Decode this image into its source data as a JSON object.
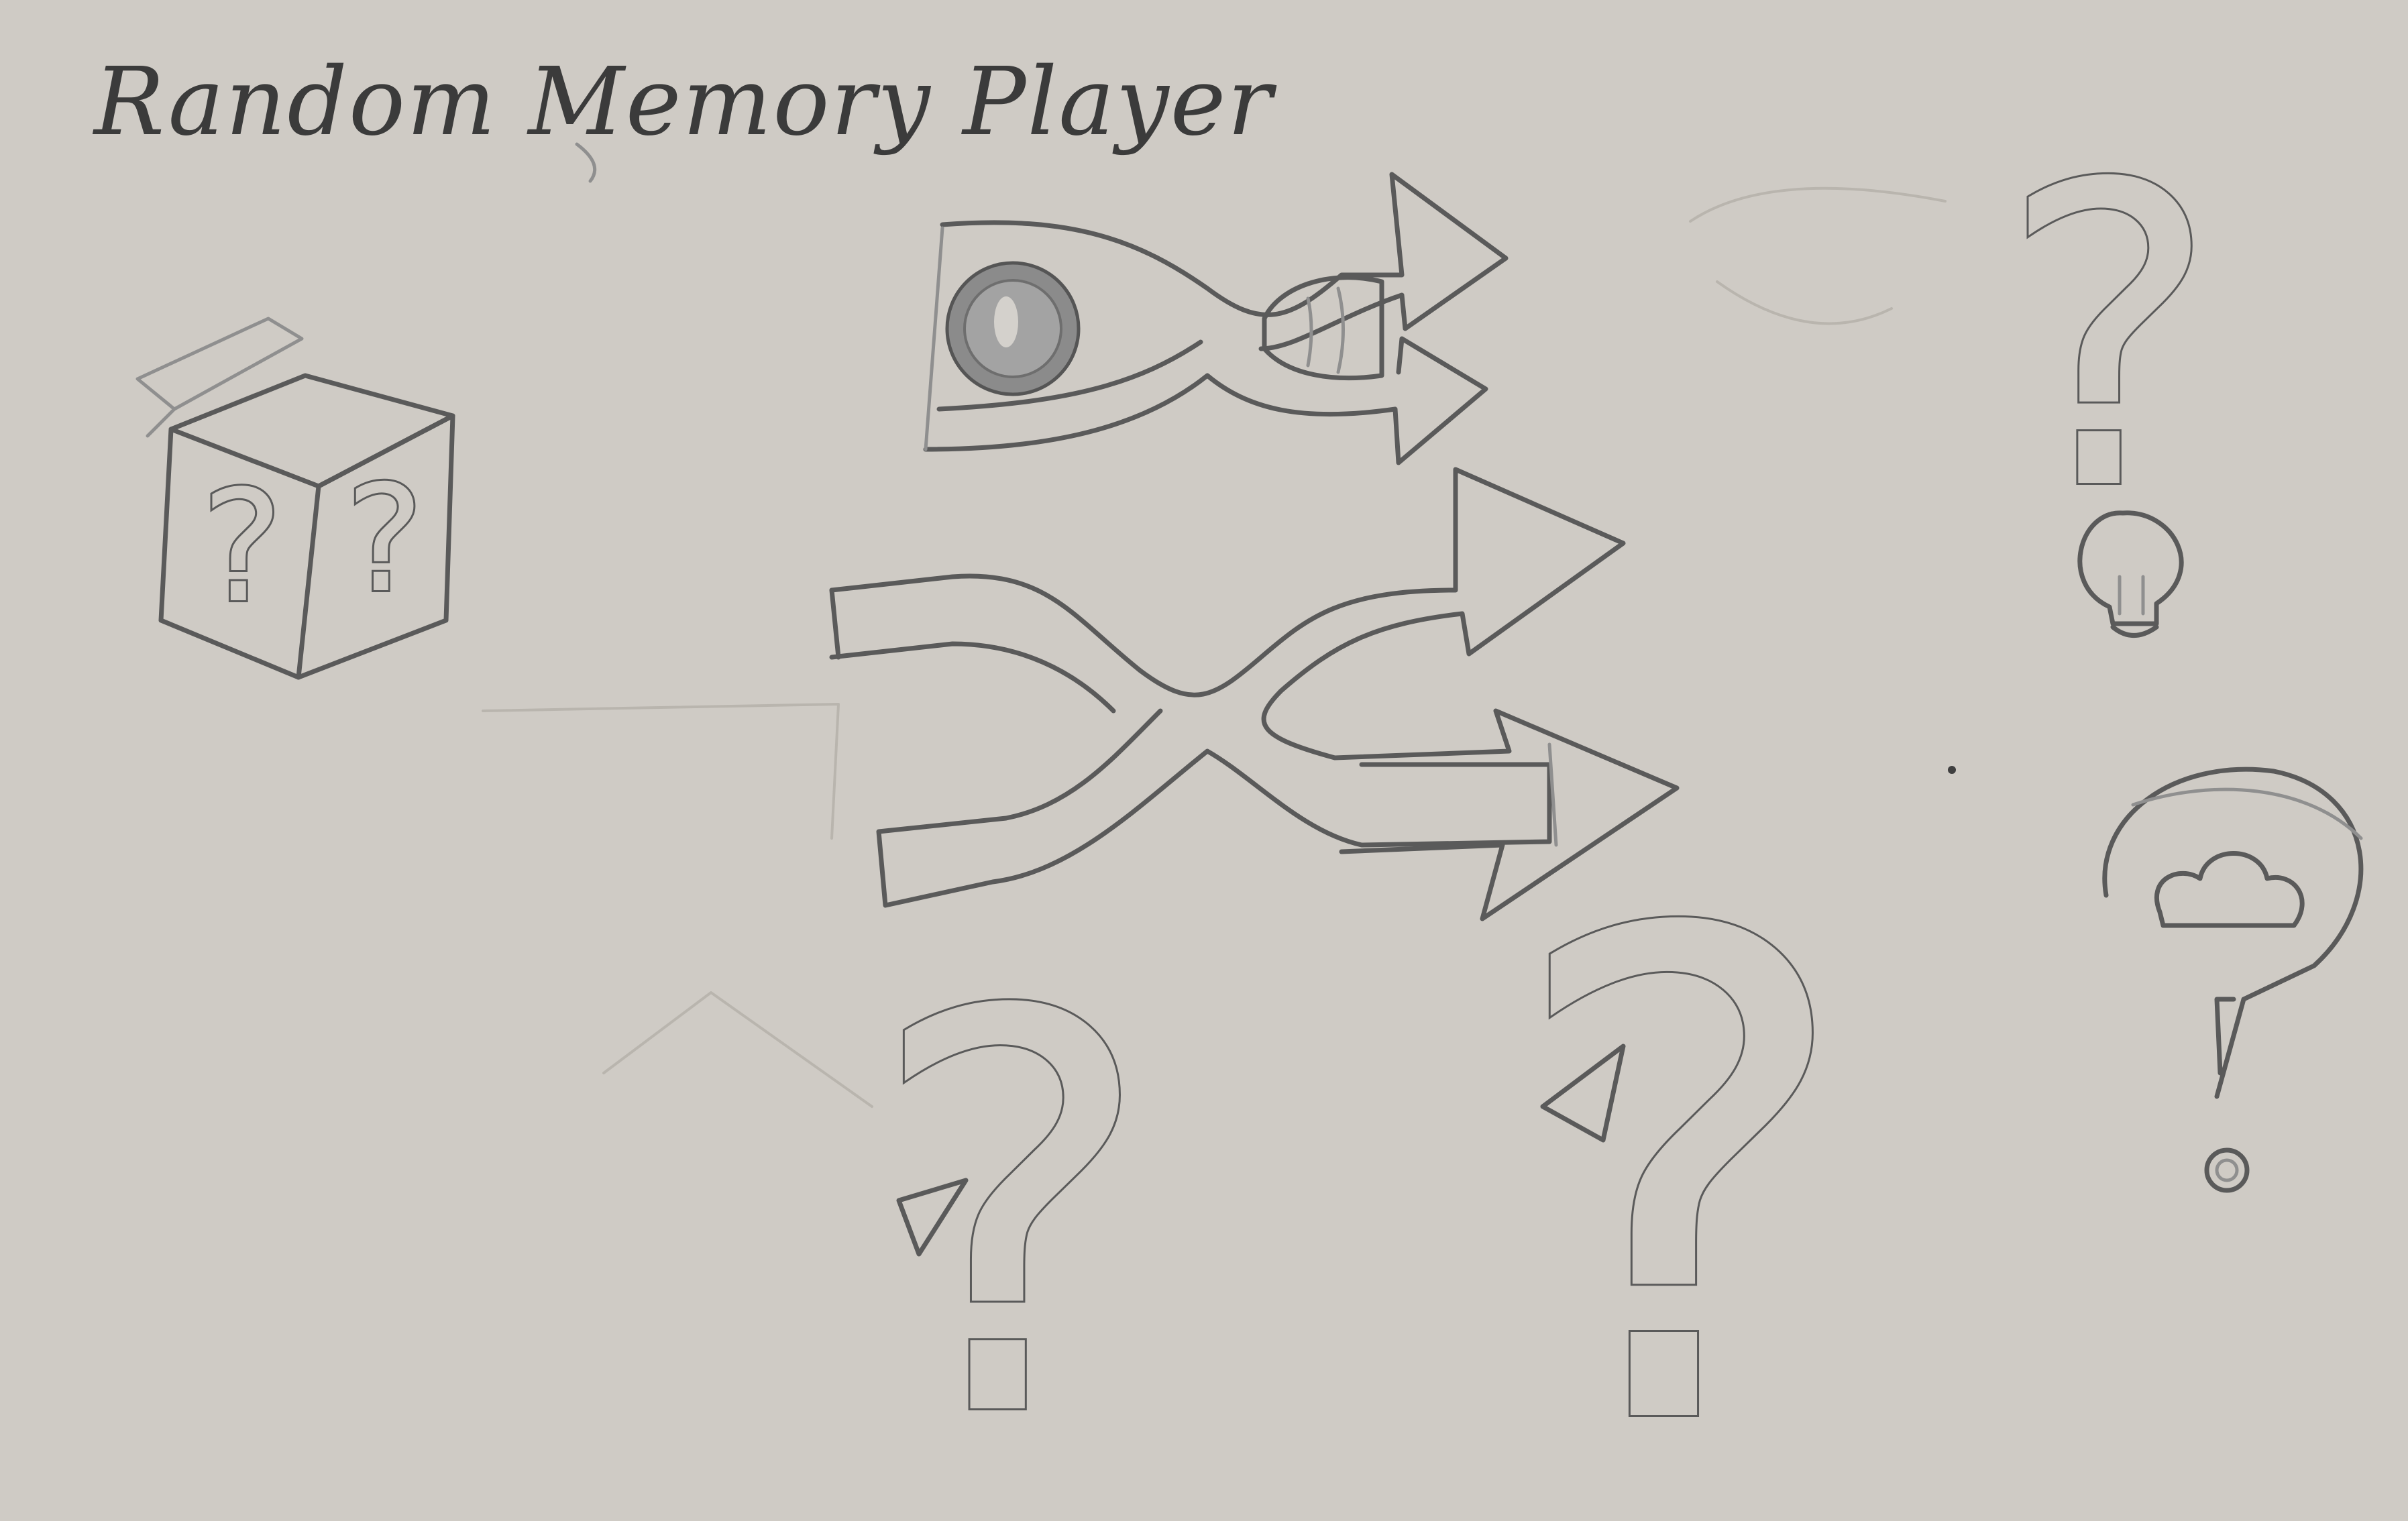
{
  "sheet": {
    "title": "Random Memory Player",
    "background_color": "#cfcbc5",
    "ink_color": "#5a5a5a"
  },
  "sketches": [
    {
      "name": "mystery-box",
      "glyph": "?"
    },
    {
      "name": "eye-shuffle-arrows"
    },
    {
      "name": "shuffle-arrows"
    },
    {
      "name": "question-mark-lightbulb",
      "glyph": "?"
    },
    {
      "name": "question-mark-cloud"
    },
    {
      "name": "question-mark-curved-arrow-small",
      "glyph": "?"
    },
    {
      "name": "question-mark-curved-arrow-large",
      "glyph": "?"
    }
  ]
}
